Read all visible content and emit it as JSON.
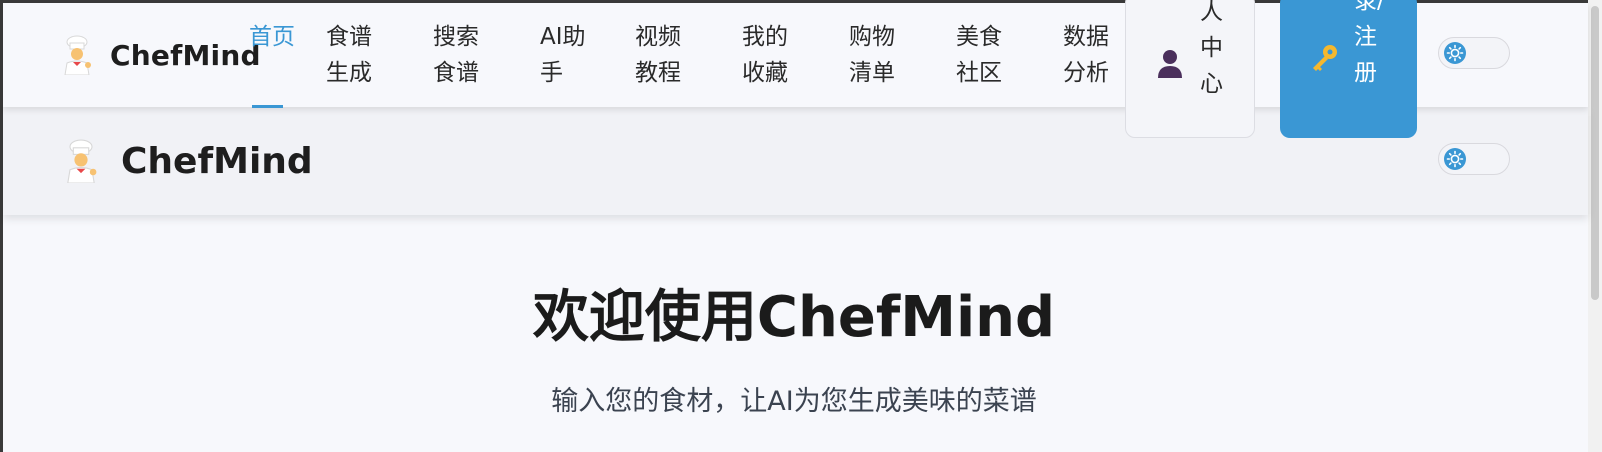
{
  "brand": {
    "name": "ChefMind",
    "icon": "chef-icon"
  },
  "nav": {
    "items": [
      {
        "label": "首页",
        "active": true
      },
      {
        "label": "食谱生成"
      },
      {
        "label": "搜索食谱"
      },
      {
        "label": "AI助手"
      },
      {
        "label": "视频教程"
      },
      {
        "label": "我的收藏"
      },
      {
        "label": "购物清单"
      },
      {
        "label": "美食社区"
      },
      {
        "label": "数据分析"
      }
    ],
    "profile": {
      "label": "个人中心",
      "visible_label": "人中心",
      "icon": "user-silhouette-icon"
    },
    "login": {
      "label": "登录/注册",
      "visible_label": "录/注册",
      "icon": "key-icon"
    },
    "theme_toggle": {
      "icon": "sun-icon",
      "mode": "light"
    }
  },
  "header2": {
    "brand_name": "ChefMind"
  },
  "hero": {
    "title": "欢迎使用ChefMind",
    "subtitle": "输入您的食材，让AI为您生成美味的菜谱"
  },
  "colors": {
    "accent": "#3a97d4",
    "background": "#f7f8fc",
    "text": "#1f1f1f"
  }
}
